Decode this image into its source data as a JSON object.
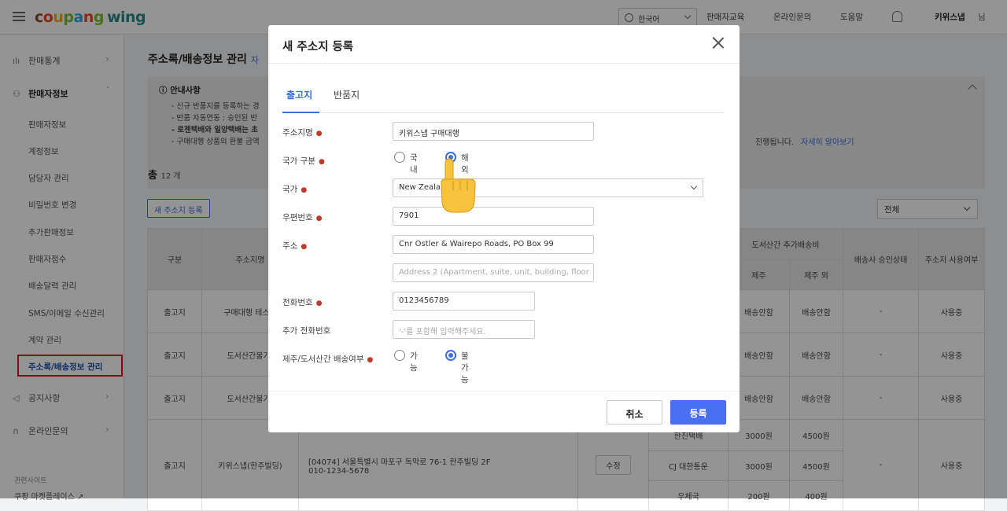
{
  "header": {
    "logo": {
      "coupang": [
        "c",
        "o",
        "u",
        "p",
        "a",
        "n",
        "g"
      ],
      "wing": "wing"
    },
    "language": "한국어",
    "links": [
      "판매자교육",
      "온라인문의",
      "도움말"
    ],
    "user": "키위스냅",
    "user_suffix": "님"
  },
  "sidebar": {
    "sections": [
      {
        "label": "판매통계",
        "icon": "bar-chart-icon"
      },
      {
        "label": "판매자정보",
        "icon": "person-icon"
      },
      {
        "label": "공지사항",
        "icon": "megaphone-icon"
      },
      {
        "label": "온라인문의",
        "icon": "headset-icon"
      }
    ],
    "items": [
      "판매자정보",
      "계정정보",
      "담당자 관리",
      "비밀번호 변경",
      "추가판매정보",
      "판매자점수",
      "배송달력 관리",
      "SMS/이메일 수신관리",
      "계약 관리",
      "주소록/배송정보 관리"
    ],
    "footer_title": "관련사이트",
    "footer_link": "쿠팡 마켓플레이스 ↗"
  },
  "page": {
    "title": "주소록/배송정보 관리",
    "title_suffix": "자",
    "notice_title": "안내사항",
    "notice_lines": [
      "- 신규 반품지를 등록하는 경",
      "- 반품 자동연동 : 승인된 반",
      "- 로젠택배와 일양택배는 초",
      "- 구매대행 상품의 환불 금액"
    ],
    "notice_tail": "진행됩니다.",
    "notice_link": "자세히 알아보기",
    "total_label": "총",
    "total_count": "12 개",
    "new_address_button": "새 주소지 등록",
    "filter_value": "전체"
  },
  "table": {
    "headers": {
      "type": "구분",
      "name": "주소지명",
      "island_fee": "도서산간 추가배송비",
      "jeju": "제주",
      "jeju_out": "제주 외",
      "carrier": "배송사 승인상태",
      "usage": "주소지 사용여부"
    },
    "rows": [
      {
        "type": "출고지",
        "name": "구매대행 테스트",
        "jeju": "배송안함",
        "jeju_out": "배송안함",
        "carrier": "-",
        "usage": "사용중"
      },
      {
        "type": "출고지",
        "name": "도서산간불가(",
        "jeju": "배송안함",
        "jeju_out": "배송안함",
        "carrier": "-",
        "usage": "사용중"
      },
      {
        "type": "출고지",
        "name": "도서산간불가(",
        "jeju": "배송안함",
        "jeju_out": "배송안함",
        "carrier": "-",
        "usage": "사용중"
      }
    ],
    "last_row": {
      "type": "출고지",
      "name": "키위스냅(한주빌딩)",
      "address": "[04074] 서울특별시 마포구 독막로 76-1 한주빌딩 2F",
      "phone": "010-1234-5678",
      "edit": "수정",
      "carriers": [
        {
          "name": "한진택배",
          "jeju": "3000원",
          "jeju_out": "4500원"
        },
        {
          "name": "CJ 대한통운",
          "jeju": "3000원",
          "jeju_out": "4500원"
        },
        {
          "name": "우체국",
          "jeju": "200원",
          "jeju_out": "400원"
        }
      ],
      "carrier": "-",
      "usage": "사용중"
    }
  },
  "modal": {
    "title": "새 주소지 등록",
    "tabs": [
      "출고지",
      "반품지"
    ],
    "fields": {
      "name_label": "주소지명",
      "name_value": "키위스냅 구매대행",
      "country_type_label": "국가 구분",
      "domestic": "국내",
      "overseas": "해외",
      "country_label": "국가",
      "country_value": "New Zealand",
      "zip_label": "우편번호",
      "zip_value": "7901",
      "address_label": "주소",
      "address1_value": "Cnr Ostler & Wairepo Roads, PO Box 99",
      "address2_placeholder": "Address 2 (Apartment, suite, unit, building, floor",
      "phone_label": "전화번호",
      "phone_value": "0123456789",
      "extra_phone_label": "추가 전화번호",
      "extra_phone_placeholder": "'-'를 포함해 입력해주세요.",
      "island_label": "제주/도서산간 배송여부",
      "possible": "가능",
      "impossible": "불가능"
    },
    "required_mark": "●",
    "cancel": "취소",
    "submit": "등록"
  },
  "colors": {
    "accent": "#3b6fd8",
    "primary_button": "#4a6ff0",
    "highlight_box": "#e0161e",
    "required": "#c0392b"
  }
}
